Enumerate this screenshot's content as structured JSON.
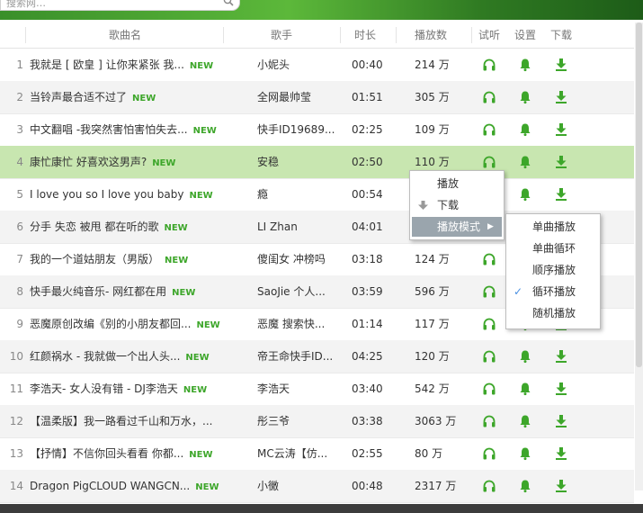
{
  "search": {
    "placeholder": "搜索网…",
    "icon": "search-icon"
  },
  "columns": {
    "song": "歌曲名",
    "singer": "歌手",
    "duration": "时长",
    "plays": "播放数",
    "listen": "试听",
    "settings": "设置",
    "download": "下载"
  },
  "new_tag": "NEW",
  "colors": {
    "accent": "#3da62a",
    "selected_row": "#c8e6b0"
  },
  "rows": [
    {
      "n": "1",
      "title": "我就是 [ 欧皇 ] 让你来紧张  我...",
      "new": true,
      "singer": "小妮头",
      "duration": "00:40",
      "plays": "214 万"
    },
    {
      "n": "2",
      "title": "当铃声最合适不过了",
      "new": true,
      "singer": "全网最帅莹",
      "duration": "01:51",
      "plays": "305 万"
    },
    {
      "n": "3",
      "title": "中文翻唱 -我突然害怕害怕失去...",
      "new": true,
      "singer": "快手ID19689...",
      "duration": "02:25",
      "plays": "109 万"
    },
    {
      "n": "4",
      "title": "康忙康忙 好喜欢这男声?",
      "new": true,
      "singer": "安稳",
      "duration": "02:50",
      "plays": "110 万"
    },
    {
      "n": "5",
      "title": "I love you so I love you baby",
      "new": true,
      "singer": "瘾",
      "duration": "00:54",
      "plays": ""
    },
    {
      "n": "6",
      "title": "分手   失恋   被甩   都在听的歌",
      "new": true,
      "singer": "LI  Zhan",
      "duration": "04:01",
      "plays": ""
    },
    {
      "n": "7",
      "title": "我的一个道姑朋友（男版）",
      "new": true,
      "singer": "傻闺女  冲榜吗",
      "duration": "03:18",
      "plays": "124 万"
    },
    {
      "n": "8",
      "title": "快手最火纯音乐- 网红都在用",
      "new": true,
      "singer": "SaoJie  个人...",
      "duration": "03:59",
      "plays": "596 万"
    },
    {
      "n": "9",
      "title": "恶魔原创改编《别的小朋友都回...",
      "new": true,
      "singer": "恶魔    搜索快...",
      "duration": "01:14",
      "plays": "117 万"
    },
    {
      "n": "10",
      "title": "红颜祸水  -   我就做一个出人头...",
      "new": true,
      "singer": "帝王命快手ID...",
      "duration": "04:25",
      "plays": "120 万"
    },
    {
      "n": "11",
      "title": "李浩天- 女人没有错  - DJ李浩天",
      "new": true,
      "singer": "李浩天",
      "duration": "03:40",
      "plays": "542 万"
    },
    {
      "n": "12",
      "title": "【温柔版】我一路看过千山和万水，...",
      "new": false,
      "singer": "彤三爷",
      "duration": "03:38",
      "plays": "3063 万"
    },
    {
      "n": "13",
      "title": "【抒情】不信你回头看看  你都...",
      "new": true,
      "singer": "MC云涛【仿...",
      "duration": "02:55",
      "plays": "80 万"
    },
    {
      "n": "14",
      "title": "Dragon PigCLOUD WANGCN...",
      "new": true,
      "singer": "小黴",
      "duration": "00:48",
      "plays": "2317 万"
    }
  ],
  "context_menu": {
    "play": "播放",
    "download": "下载",
    "play_mode": "播放模式"
  },
  "play_mode_menu": {
    "items": [
      "单曲播放",
      "单曲循环",
      "顺序播放",
      "循环播放",
      "随机播放"
    ],
    "checked": "循环播放"
  }
}
